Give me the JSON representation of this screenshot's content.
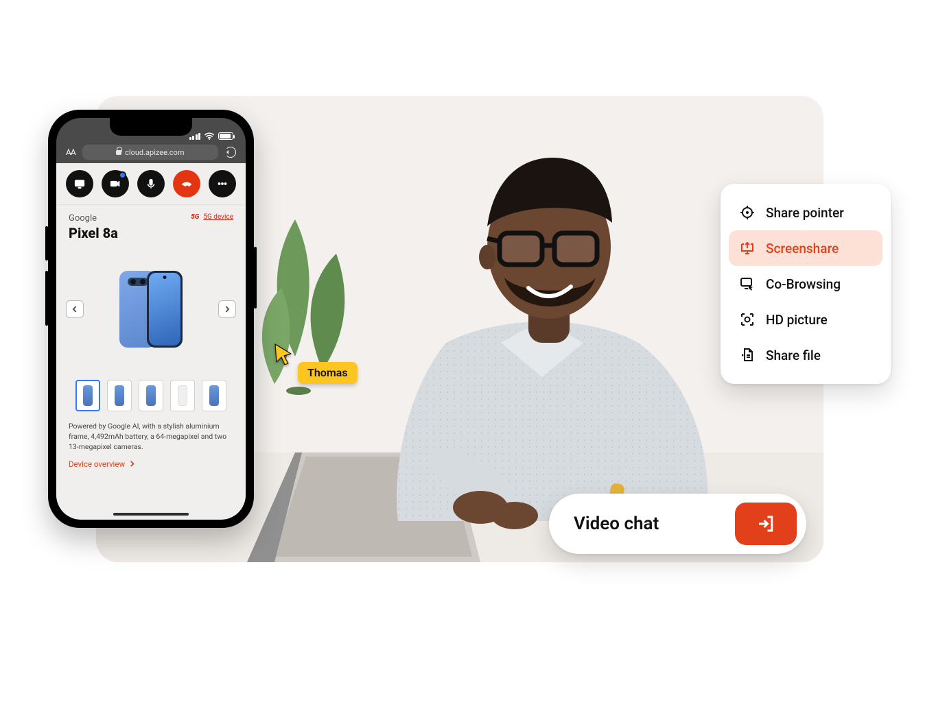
{
  "photo_alt": "Man with glasses smiling at a laptop during a video support session",
  "phone": {
    "status": {
      "signal": "4 bars",
      "wifi": "on",
      "battery": "full"
    },
    "browser": {
      "url": "cloud.apizee.com",
      "secure": true
    },
    "call_controls": [
      "screen",
      "camera",
      "mic",
      "hangup",
      "more"
    ],
    "product": {
      "brand": "Google",
      "name": "Pixel 8a",
      "network_badge": "5G",
      "network_label": "5G device",
      "description": "Powered by Google AI, with a stylish aluminium frame, 4,492mAh battery, a 64-megapixel and two 13-megapixel cameras.",
      "overview_link": "Device overview",
      "thumbnail_count": 5,
      "selected_thumbnail": 0
    }
  },
  "remote_cursor": {
    "user": "Thomas",
    "color": "#fcc521"
  },
  "share_menu": {
    "items": [
      {
        "id": "share-pointer",
        "label": "Share pointer",
        "active": false
      },
      {
        "id": "screenshare",
        "label": "Screenshare",
        "active": true
      },
      {
        "id": "co-browsing",
        "label": "Co-Browsing",
        "active": false
      },
      {
        "id": "hd-picture",
        "label": "HD picture",
        "active": false
      },
      {
        "id": "share-file",
        "label": "Share file",
        "active": false
      }
    ]
  },
  "video_chat": {
    "label": "Video chat"
  }
}
